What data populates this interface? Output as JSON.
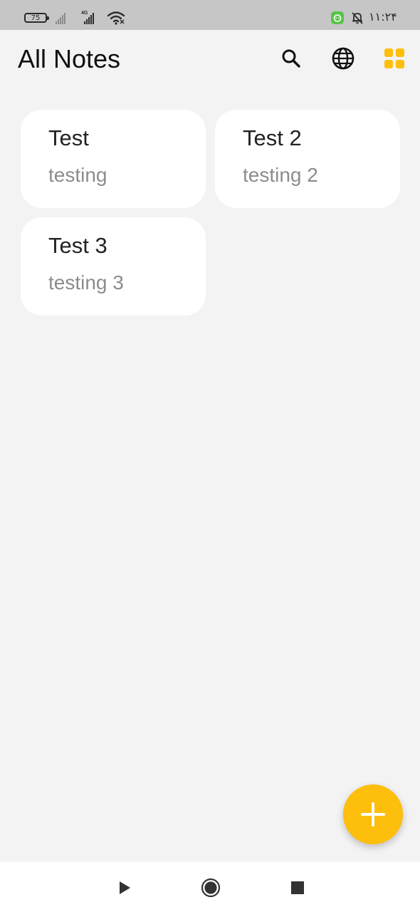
{
  "status_bar": {
    "battery_level": "75",
    "network_type": "4G",
    "clock": "۱۱:۲۴",
    "icons": [
      "battery-icon",
      "signal-icon",
      "wifi-icon",
      "app-notification-icon",
      "bell-off-icon"
    ]
  },
  "header": {
    "title": "All Notes",
    "actions": [
      "search-icon",
      "globe-icon",
      "grid-view-icon"
    ]
  },
  "notes": [
    {
      "title": "Test",
      "body": "testing"
    },
    {
      "title": "Test 2",
      "body": "testing 2"
    },
    {
      "title": "Test 3",
      "body": "testing 3"
    }
  ],
  "fab": {
    "icon": "plus-icon"
  },
  "nav_bar": {
    "icons": [
      "back-play-icon",
      "home-circle-icon",
      "recents-square-icon"
    ]
  },
  "colors": {
    "accent": "#fdbe0c",
    "background": "#f3f3f3",
    "card": "#ffffff",
    "status_bar": "#c6c6c6"
  }
}
